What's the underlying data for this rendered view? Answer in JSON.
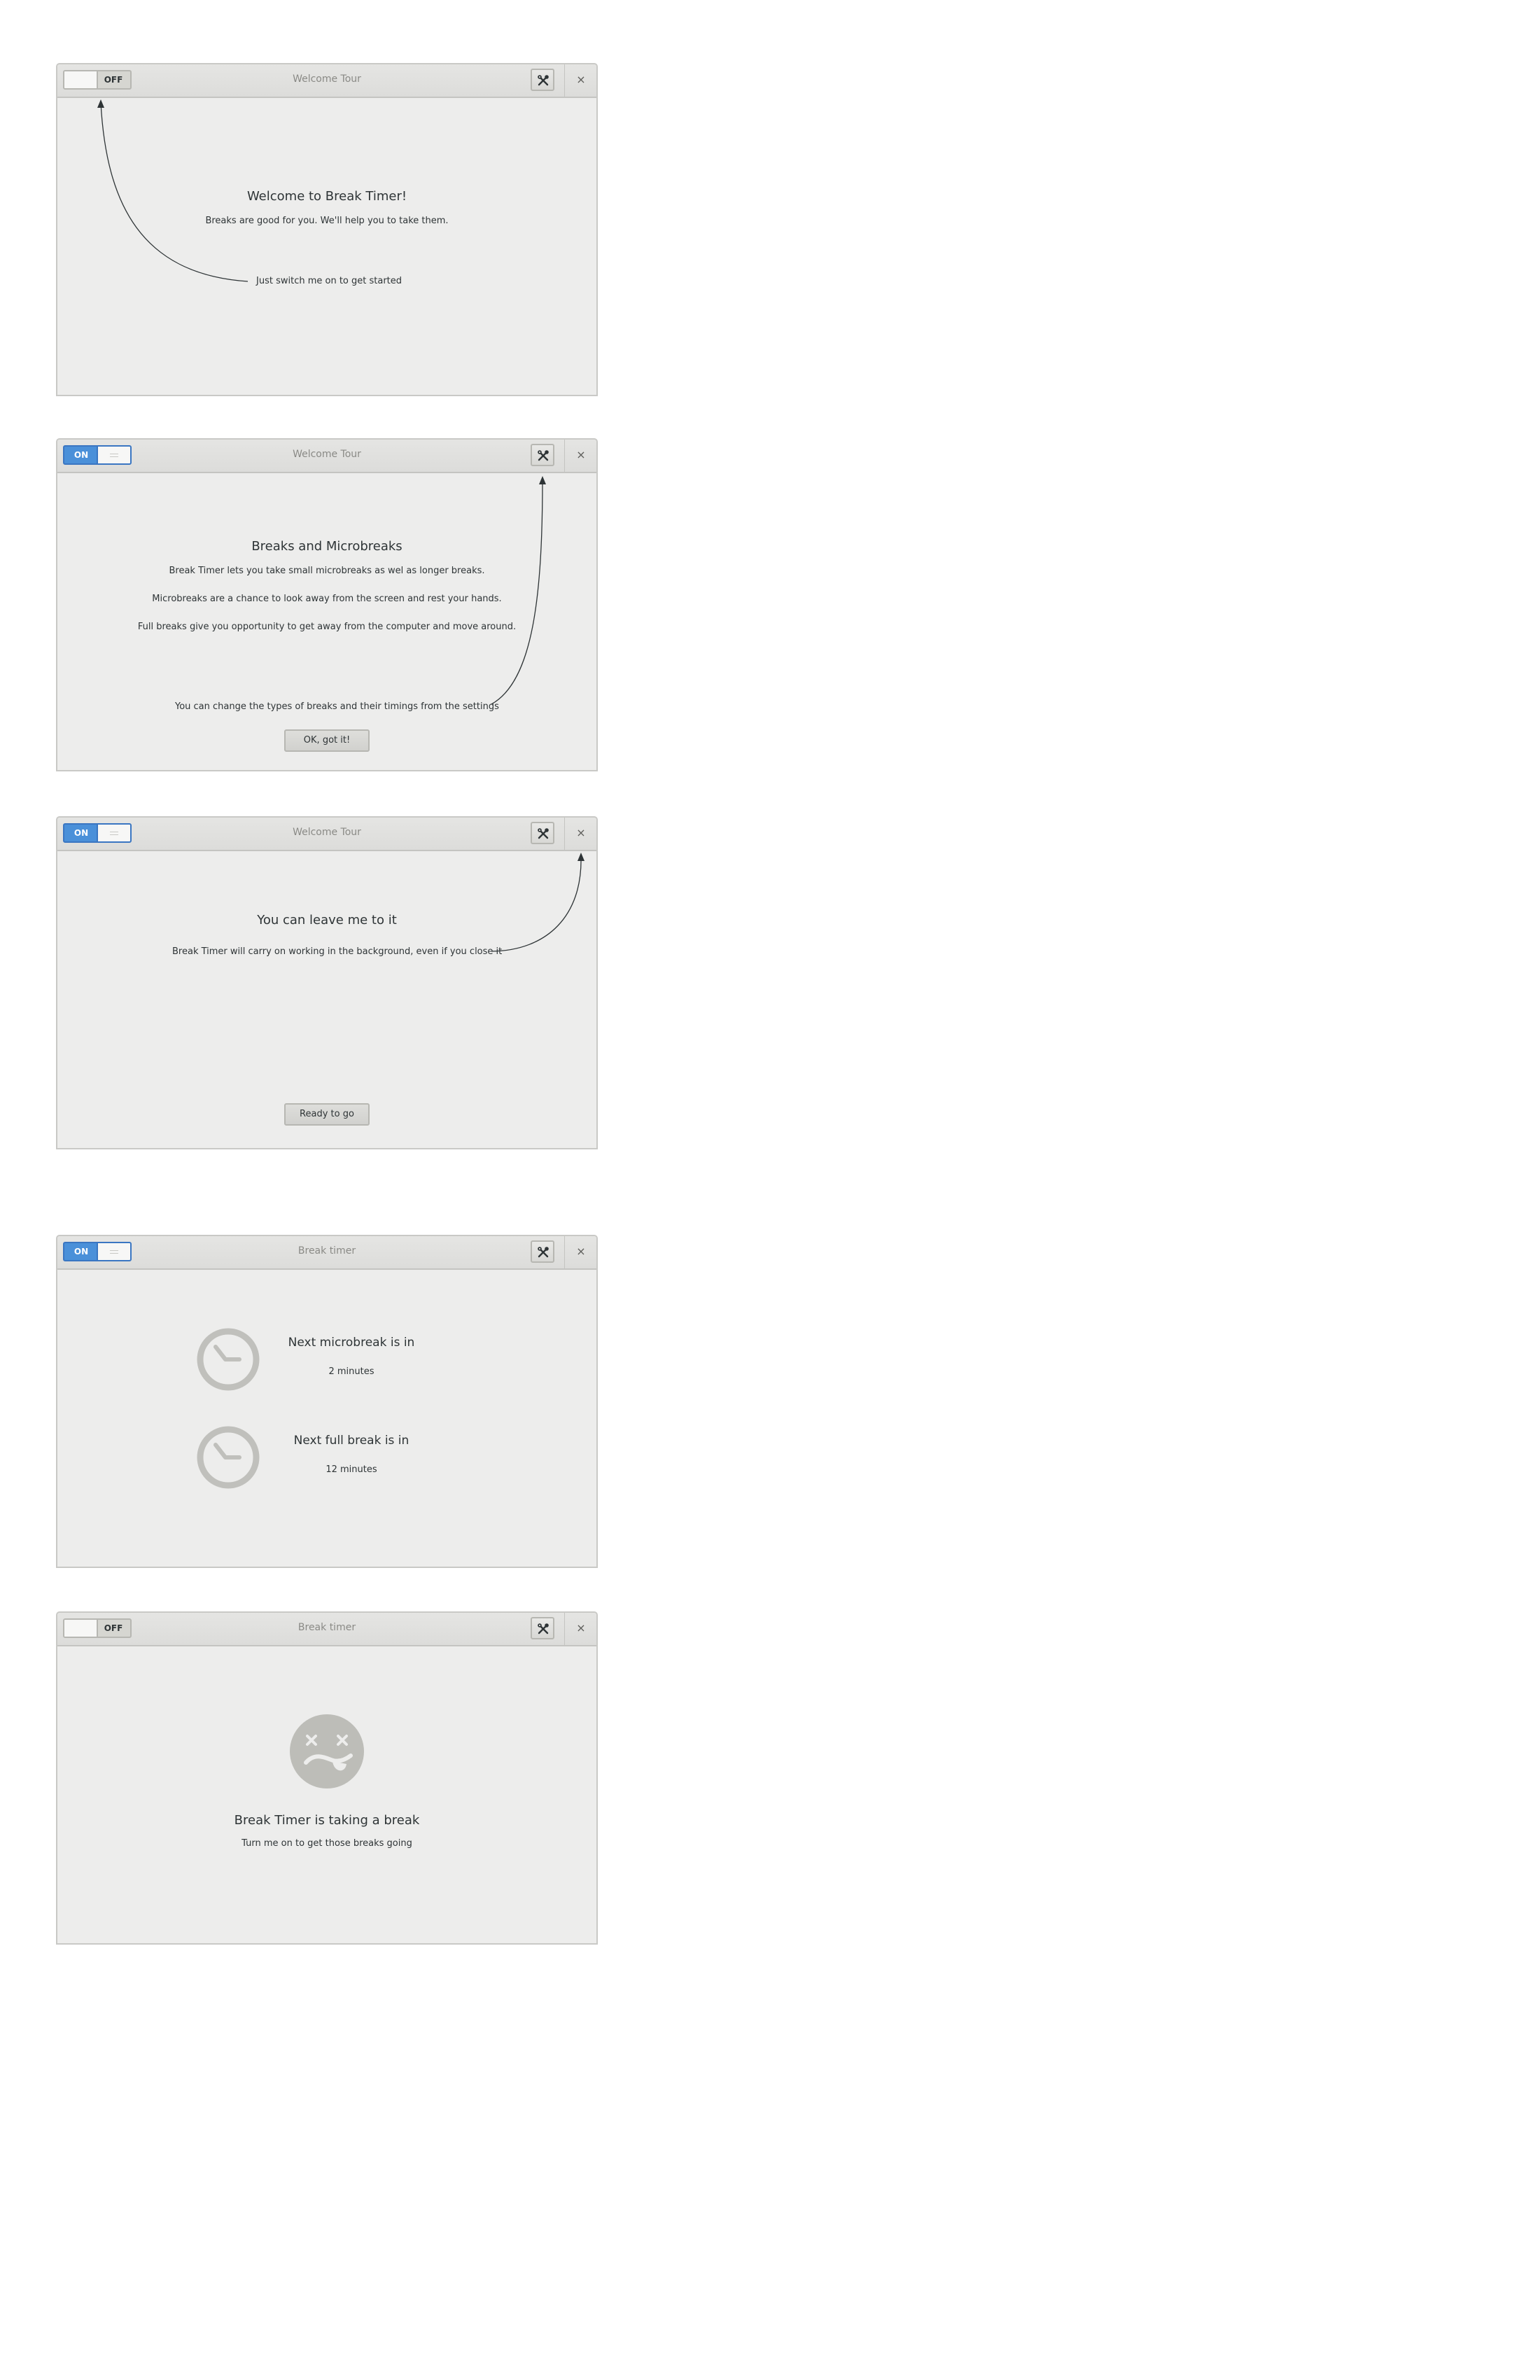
{
  "windows": [
    {
      "title": "Welcome Tour",
      "switch_label": "OFF",
      "close_glyph": "×",
      "heading": "Welcome to Break Timer!",
      "body": "Breaks are good for you. We'll help you to take them.",
      "hint": "Just switch me on to get started"
    },
    {
      "title": "Welcome Tour",
      "switch_label": "ON",
      "close_glyph": "×",
      "heading": "Breaks and Microbreaks",
      "paragraphs": [
        "Break Timer lets you take small microbreaks as wel as longer breaks.",
        "Microbreaks are a chance to look away from the screen and rest your hands.",
        "Full breaks give you opportunity to get away from the computer and move around."
      ],
      "hint": "You can change the types of breaks and their timings from the settings",
      "button": "OK, got it!"
    },
    {
      "title": "Welcome Tour",
      "switch_label": "ON",
      "close_glyph": "×",
      "heading": "You can leave me to it",
      "body": "Break Timer will carry on working in the background, even if you close it",
      "button": "Ready to go"
    },
    {
      "title": "Break timer",
      "switch_label": "ON",
      "close_glyph": "×",
      "microbreak_title": "Next microbreak is in",
      "microbreak_time": "2 minutes",
      "fullbreak_title": "Next full break is in",
      "fullbreak_time": "12 minutes"
    },
    {
      "title": "Break timer",
      "switch_label": "OFF",
      "close_glyph": "×",
      "heading": "Break Timer is taking a break",
      "body": "Turn me on to get those breaks going"
    }
  ],
  "icons": {
    "settings": "tools-icon",
    "close": "close-icon",
    "clock": "clock-icon",
    "status_face": "dizzy-face-icon"
  },
  "colors": {
    "accent": "#4a90d9",
    "window_bg": "#ededec",
    "icon_gray": "#c0c0bc"
  }
}
